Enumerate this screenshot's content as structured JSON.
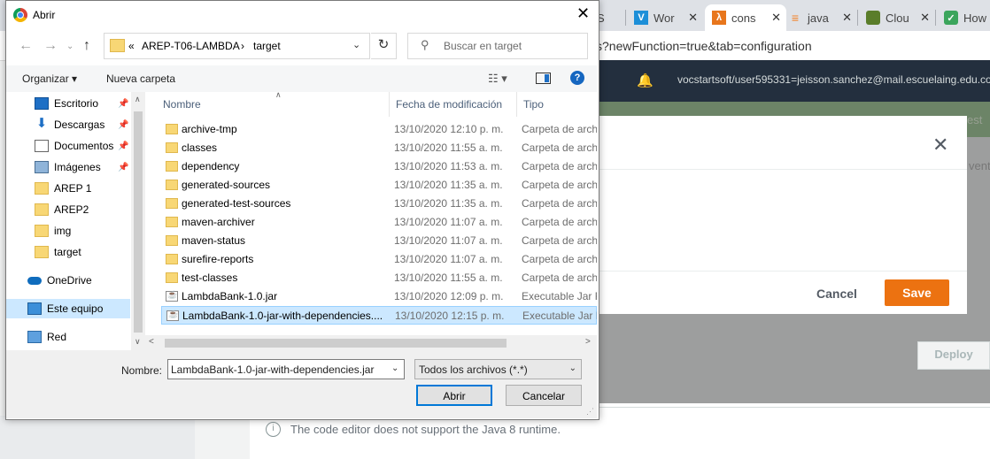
{
  "browser": {
    "tabs": [
      {
        "label": "S",
        "icon": "tab-icon-partial"
      },
      {
        "label": "Wor",
        "icon": "v-icon"
      },
      {
        "label": "cons",
        "icon": "lambda-icon"
      },
      {
        "label": "java",
        "icon": "stackoverflow-icon"
      },
      {
        "label": "Clou",
        "icon": "cloud-icon"
      },
      {
        "label": "How",
        "icon": "leaf-icon"
      }
    ],
    "url_fragment": "s?newFunction=true&tab=configuration"
  },
  "aws": {
    "account": "vocstartsoft/user595331=jeisson.sanchez@mail.escuelaing.edu.co",
    "banner_fragment": "est",
    "events_fragment": "vent",
    "cancel_label": "Cancel",
    "save_label": "Save",
    "deploy_label": "Deploy",
    "notice": "The code editor does not support the Java 8 runtime.",
    "colors": {
      "save": "#ec7211",
      "nav": "#232f3e"
    }
  },
  "dialog": {
    "title": "Abrir",
    "breadcrumb": {
      "overflow": "«",
      "parent": "AREP-T06-LAMBDA",
      "sep": "›",
      "current": "target"
    },
    "search_placeholder": "Buscar en target",
    "organize_label": "Organizar ▾",
    "new_folder_label": "Nueva carpeta",
    "nav_items": [
      {
        "label": "Escritorio",
        "icon": "desktop-icon",
        "pinned": true
      },
      {
        "label": "Descargas",
        "icon": "download-icon",
        "pinned": true
      },
      {
        "label": "Documentos",
        "icon": "documents-icon",
        "pinned": true
      },
      {
        "label": "Imágenes",
        "icon": "pictures-icon",
        "pinned": true
      },
      {
        "label": "AREP 1",
        "icon": "folder-icon",
        "pinned": false
      },
      {
        "label": "AREP2",
        "icon": "folder-icon",
        "pinned": false
      },
      {
        "label": "img",
        "icon": "folder-icon",
        "pinned": false
      },
      {
        "label": "target",
        "icon": "folder-icon",
        "pinned": false
      },
      {
        "label": "OneDrive",
        "icon": "onedrive-icon",
        "pinned": false
      },
      {
        "label": "Este equipo",
        "icon": "this-pc-icon",
        "pinned": false
      },
      {
        "label": "Red",
        "icon": "network-icon",
        "pinned": false
      }
    ],
    "columns": [
      "Nombre",
      "Fecha de modificación",
      "Tipo"
    ],
    "files": [
      {
        "name": "archive-tmp",
        "date": "13/10/2020 12:10 p. m.",
        "type": "Carpeta de archivos",
        "kind": "folder"
      },
      {
        "name": "classes",
        "date": "13/10/2020 11:55 a. m.",
        "type": "Carpeta de archivos",
        "kind": "folder"
      },
      {
        "name": "dependency",
        "date": "13/10/2020 11:53 a. m.",
        "type": "Carpeta de archivos",
        "kind": "folder"
      },
      {
        "name": "generated-sources",
        "date": "13/10/2020 11:35 a. m.",
        "type": "Carpeta de archivos",
        "kind": "folder"
      },
      {
        "name": "generated-test-sources",
        "date": "13/10/2020 11:35 a. m.",
        "type": "Carpeta de archivos",
        "kind": "folder"
      },
      {
        "name": "maven-archiver",
        "date": "13/10/2020 11:07 a. m.",
        "type": "Carpeta de archivos",
        "kind": "folder"
      },
      {
        "name": "maven-status",
        "date": "13/10/2020 11:07 a. m.",
        "type": "Carpeta de archivos",
        "kind": "folder"
      },
      {
        "name": "surefire-reports",
        "date": "13/10/2020 11:07 a. m.",
        "type": "Carpeta de archivos",
        "kind": "folder"
      },
      {
        "name": "test-classes",
        "date": "13/10/2020 11:55 a. m.",
        "type": "Carpeta de archivos",
        "kind": "folder"
      },
      {
        "name": "LambdaBank-1.0.jar",
        "date": "13/10/2020 12:09 p. m.",
        "type": "Executable Jar File",
        "kind": "jar"
      },
      {
        "name": "LambdaBank-1.0-jar-with-dependencies....",
        "date": "13/10/2020 12:15 p. m.",
        "type": "Executable Jar File",
        "kind": "jar",
        "selected": true
      }
    ],
    "name_label": "Nombre:",
    "name_value": "LambdaBank-1.0-jar-with-dependencies.jar",
    "filter_value": "Todos los archivos (*.*)",
    "open_label": "Abrir",
    "cancel_label": "Cancelar"
  }
}
